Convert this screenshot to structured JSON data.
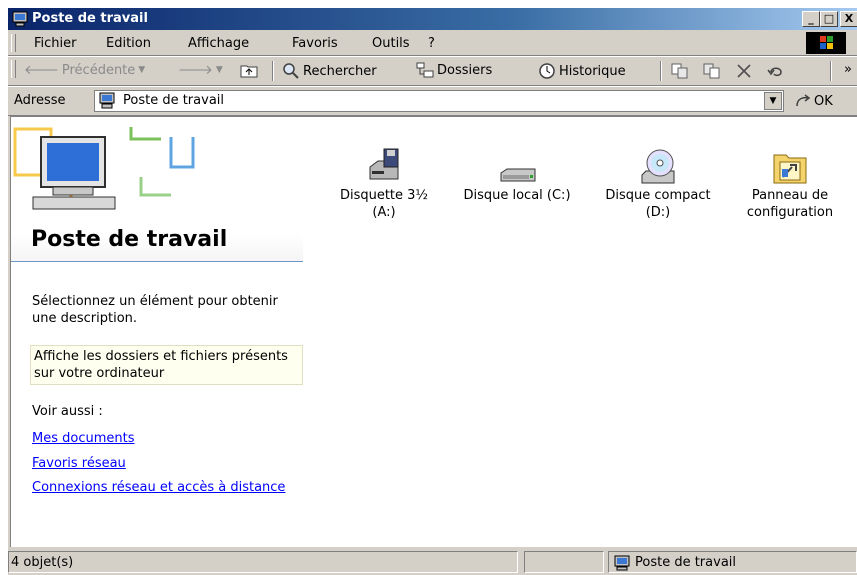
{
  "window": {
    "title": "Poste de travail"
  },
  "titlebar_buttons": {
    "minimize": "_",
    "maximize": "□",
    "close": "X"
  },
  "menubar": {
    "items": [
      {
        "label": "Fichier"
      },
      {
        "label": "Edition"
      },
      {
        "label": "Affichage"
      },
      {
        "label": "Favoris"
      },
      {
        "label": "Outils"
      },
      {
        "label": "?"
      }
    ]
  },
  "toolbar": {
    "back_label": "Précédente",
    "search_label": "Rechercher",
    "folders_label": "Dossiers",
    "history_label": "Historique",
    "more": "»"
  },
  "address": {
    "label": "Adresse",
    "value": "Poste de travail",
    "go_label": "OK"
  },
  "left_pane": {
    "title": "Poste de travail",
    "description": "Sélectionnez un élément pour obtenir une description.",
    "info": "Affiche les dossiers et fichiers présents sur votre ordinateur",
    "see_also": "Voir aussi :",
    "links": [
      "Mes documents",
      "Favoris réseau",
      "Connexions réseau et accès à distance"
    ]
  },
  "drives": [
    {
      "label": "Disquette 3½\n(A:)",
      "icon": "floppy-drive-icon"
    },
    {
      "label": "Disque local (C:)",
      "icon": "hard-disk-icon"
    },
    {
      "label": "Disque compact\n(D:)",
      "icon": "cd-drive-icon"
    },
    {
      "label": "Panneau de\nconfiguration",
      "icon": "control-panel-icon"
    }
  ],
  "statusbar": {
    "count": "4 objet(s)",
    "location": "Poste de travail"
  }
}
